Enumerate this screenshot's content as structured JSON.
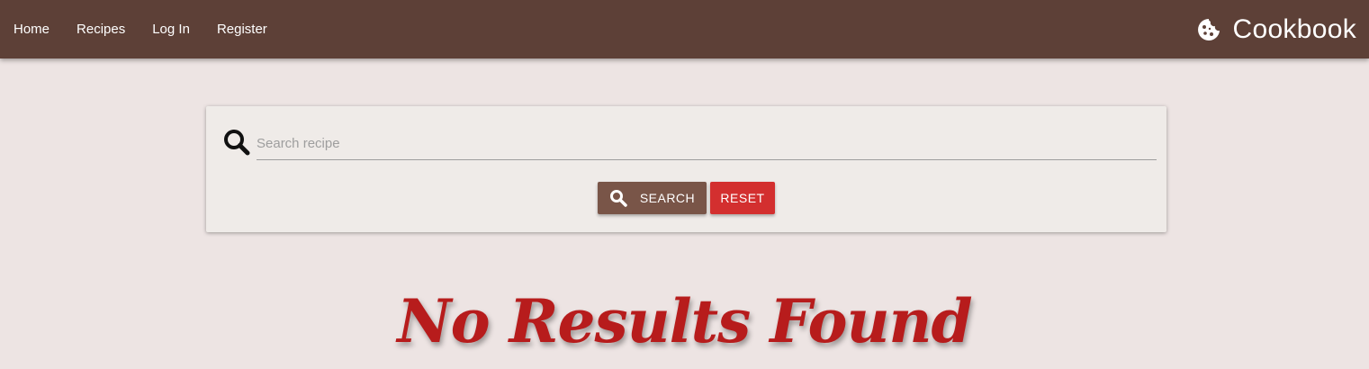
{
  "nav": {
    "links": [
      {
        "label": "Home"
      },
      {
        "label": "Recipes"
      },
      {
        "label": "Log In"
      },
      {
        "label": "Register"
      }
    ],
    "brand": {
      "name": "Cookbook",
      "icon": "cookie-icon"
    }
  },
  "search": {
    "icon": "search-icon",
    "placeholder": "Search recipe",
    "value": "",
    "search_button": {
      "label": "SEARCH",
      "icon": "search-icon"
    },
    "reset_button": {
      "label": "RESET"
    }
  },
  "results": {
    "message": "No Results Found"
  },
  "colors": {
    "navbar": "#5d4037",
    "background": "#ede4e3",
    "card": "#efebe8",
    "search_button": "#795548",
    "reset_button": "#d32f2f",
    "message": "#b71c1c"
  }
}
